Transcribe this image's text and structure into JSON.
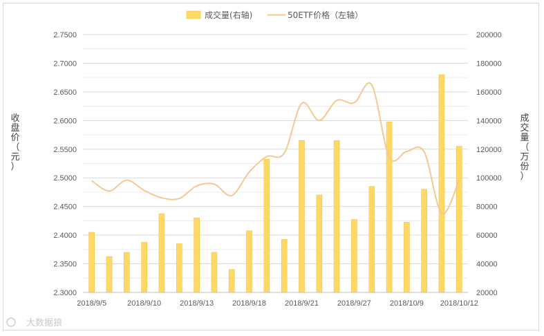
{
  "chart_data": {
    "type": "bar+line",
    "legend": [
      {
        "label": "成交量(右轴)",
        "color": "#FFD966"
      },
      {
        "label": "50ETF价格（左轴）",
        "color": "#F4C890"
      }
    ],
    "y_left_title": "收盘价（元）",
    "y_right_title": "成交量（万份）",
    "y_left_ylim": [
      2.3,
      2.75
    ],
    "y_left_ticks": [
      "2.3000",
      "2.3500",
      "2.4000",
      "2.4500",
      "2.5000",
      "2.5500",
      "2.6000",
      "2.6500",
      "2.7000",
      "2.7500"
    ],
    "y_right_ylim": [
      20000,
      200000
    ],
    "y_right_ticks": [
      "20000",
      "40000",
      "60000",
      "80000",
      "100000",
      "120000",
      "140000",
      "160000",
      "180000",
      "200000"
    ],
    "x_tick_labels": [
      "2018/9/5",
      "2018/9/10",
      "2018/9/13",
      "2018/9/18",
      "2018/9/21",
      "2018/9/27",
      "2018/10/9",
      "2018/10/12"
    ],
    "x_tick_positions": [
      0,
      3,
      6,
      9,
      12,
      15,
      18,
      21
    ],
    "volume": [
      62000,
      45000,
      48000,
      55000,
      75000,
      54000,
      72000,
      48000,
      36000,
      63000,
      113000,
      57000,
      126000,
      88000,
      126000,
      71000,
      94000,
      139000,
      69000,
      92000,
      172000,
      122000
    ],
    "price": [
      2.495,
      2.477,
      2.496,
      2.478,
      2.465,
      2.464,
      2.486,
      2.489,
      2.469,
      2.51,
      2.537,
      2.543,
      2.63,
      2.6,
      2.635,
      2.631,
      2.662,
      2.536,
      2.546,
      2.545,
      2.438,
      2.496
    ],
    "grid": true
  },
  "watermark": "大数据狼"
}
